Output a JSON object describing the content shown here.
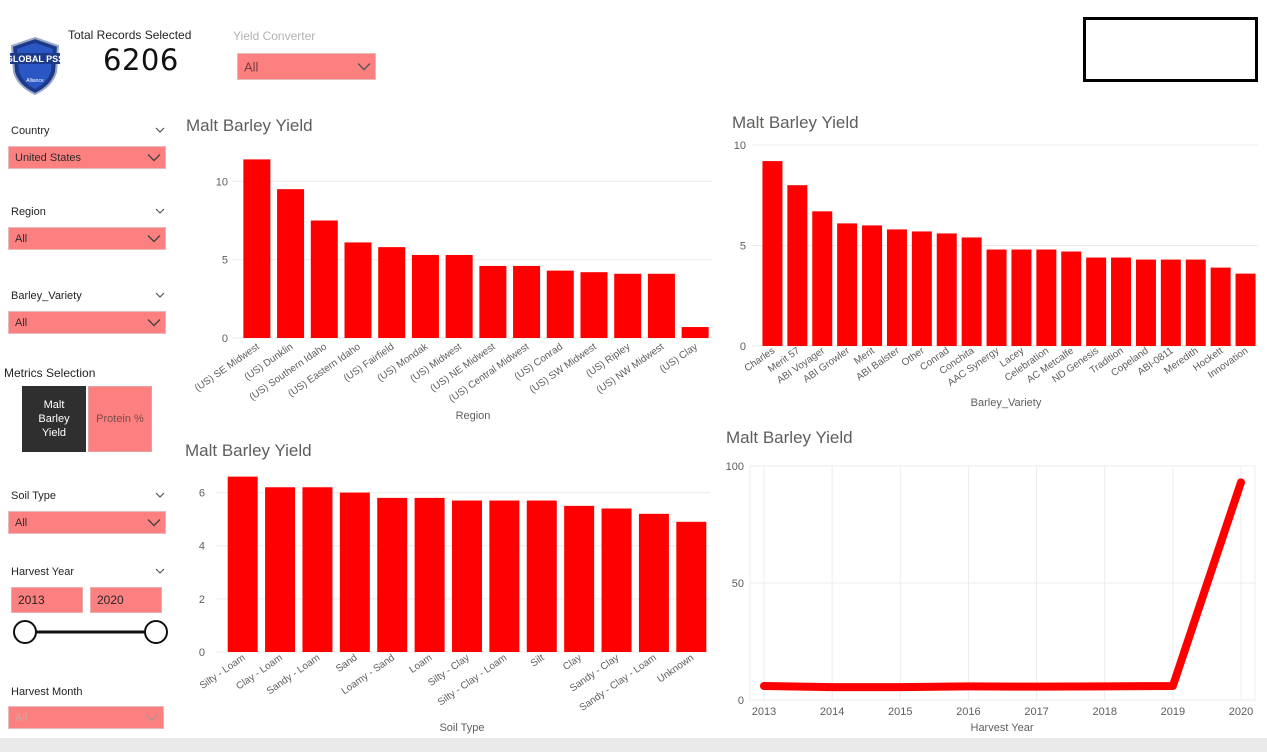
{
  "header": {
    "logo_text": "GLOBAL PSS",
    "logo_subtext": "Alliance",
    "kpi_label": "Total Records Selected",
    "kpi_value": "6206",
    "yield_converter": {
      "label": "Yield Converter",
      "value": "All"
    }
  },
  "filters": {
    "country": {
      "label": "Country",
      "value": "United States"
    },
    "region": {
      "label": "Region",
      "value": "All"
    },
    "barley_variety": {
      "label": "Barley_Variety",
      "value": "All"
    },
    "metrics": {
      "title": "Metrics Selection",
      "options": [
        "Malt Barley Yield",
        "Protein %"
      ],
      "selected": "Malt Barley Yield"
    },
    "soil_type": {
      "label": "Soil Type",
      "value": "All"
    },
    "harvest_year": {
      "label": "Harvest Year",
      "from": "2013",
      "to": "2020"
    },
    "harvest_month": {
      "label": "Harvest Month",
      "value": "All"
    }
  },
  "colors": {
    "bar": "#ff0000",
    "dropdown": "#fd8080",
    "selected_button": "#2f2f2f",
    "grid": "#ececec"
  },
  "chart_data": [
    {
      "id": "region",
      "type": "bar",
      "title": "Malt Barley Yield",
      "xlabel": "Region",
      "ylabel": "",
      "ylim": [
        0,
        12
      ],
      "yticks": [
        0,
        5,
        10
      ],
      "categories": [
        "(US) SE Midwest",
        "(US) Dunklin",
        "(US) Southern Idaho",
        "(US) Eastern Idaho",
        "(US) Fairfield",
        "(US) Mondak",
        "(US) Midwest",
        "(US) NE Midwest",
        "(US) Central Midwest",
        "(US) Conrad",
        "(US) SW Midwest",
        "(US) Ripley",
        "(US) NW Midwest",
        "(US) Clay"
      ],
      "values": [
        11.4,
        9.5,
        7.5,
        6.1,
        5.8,
        5.3,
        5.3,
        4.6,
        4.6,
        4.3,
        4.2,
        4.1,
        4.1,
        0.7
      ]
    },
    {
      "id": "variety",
      "type": "bar",
      "title": "Malt Barley Yield",
      "xlabel": "Barley_Variety",
      "ylabel": "",
      "ylim": [
        0,
        10
      ],
      "yticks": [
        0,
        5,
        10
      ],
      "categories": [
        "Charles",
        "Merit 57",
        "ABI Voyager",
        "ABI Growler",
        "Merit",
        "ABI Balster",
        "Other",
        "Conrad",
        "Conchita",
        "AAC Synergy",
        "Lacey",
        "Celebration",
        "AC Metcalfe",
        "ND Genesis",
        "Tradition",
        "Copeland",
        "ABI-0811",
        "Meredith",
        "Hockett",
        "Innovation"
      ],
      "values": [
        9.2,
        8.0,
        6.7,
        6.1,
        6.0,
        5.8,
        5.7,
        5.6,
        5.4,
        4.8,
        4.8,
        4.8,
        4.7,
        4.4,
        4.4,
        4.3,
        4.3,
        4.3,
        3.9,
        3.6
      ]
    },
    {
      "id": "soil",
      "type": "bar",
      "title": "Malt Barley Yield",
      "xlabel": "Soil Type",
      "ylabel": "",
      "ylim": [
        0,
        7
      ],
      "yticks": [
        0,
        2,
        4,
        6
      ],
      "categories": [
        "Silty - Loam",
        "Clay - Loam",
        "Sandy - Loam",
        "Sand",
        "Loamy - Sand",
        "Loam",
        "Silty - Clay",
        "Silty - Clay - Loam",
        "Silt",
        "Clay",
        "Sandy - Clay",
        "Sandy - Clay - Loam",
        "Unknown"
      ],
      "values": [
        6.6,
        6.2,
        6.2,
        6.0,
        5.8,
        5.8,
        5.7,
        5.7,
        5.7,
        5.5,
        5.4,
        5.2,
        4.9
      ]
    },
    {
      "id": "year",
      "type": "line",
      "title": "Malt Barley Yield",
      "xlabel": "Harvest Year",
      "ylabel": "",
      "ylim": [
        0,
        100
      ],
      "yticks": [
        0,
        50,
        100
      ],
      "x": [
        "2013",
        "2014",
        "2015",
        "2016",
        "2017",
        "2018",
        "2019",
        "2020"
      ],
      "values": [
        6.0,
        5.5,
        5.5,
        5.8,
        5.7,
        5.8,
        6.0,
        93.0
      ]
    }
  ]
}
